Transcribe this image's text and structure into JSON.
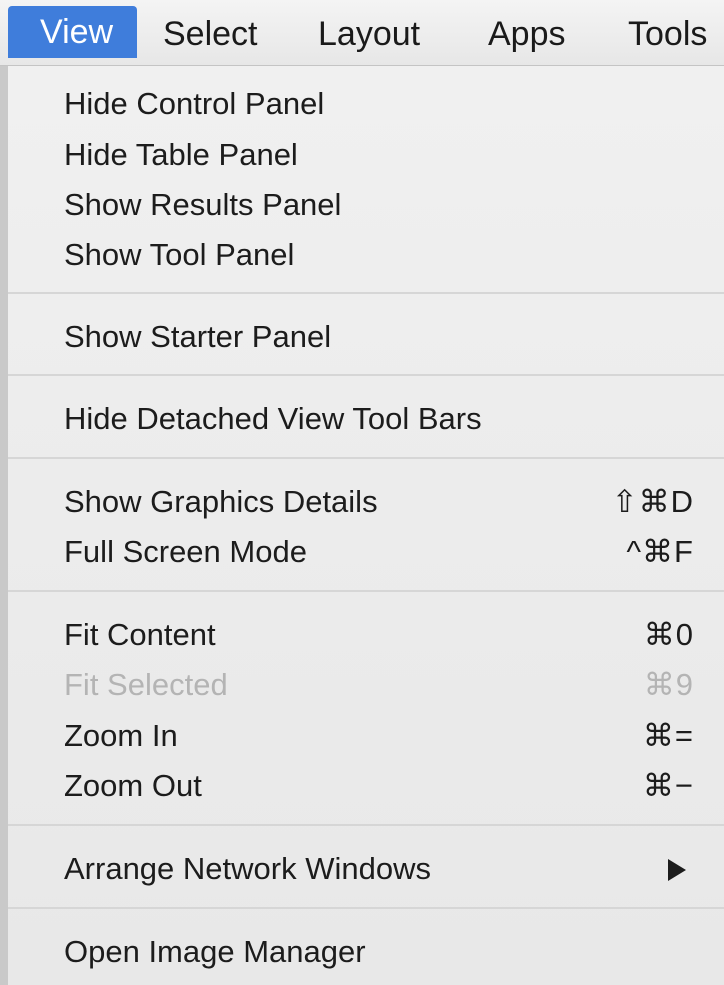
{
  "menubar": {
    "items": [
      {
        "label": "View",
        "active": true
      },
      {
        "label": "Select"
      },
      {
        "label": "Layout"
      },
      {
        "label": "Apps"
      },
      {
        "label": "Tools"
      }
    ]
  },
  "menu": {
    "groups": [
      {
        "items": [
          {
            "label": "Hide Control Panel"
          },
          {
            "label": "Hide Table Panel"
          },
          {
            "label": "Show Results Panel"
          },
          {
            "label": "Show Tool Panel"
          }
        ]
      },
      {
        "items": [
          {
            "label": "Show Starter Panel"
          }
        ]
      },
      {
        "items": [
          {
            "label": "Hide Detached View Tool Bars"
          }
        ]
      },
      {
        "items": [
          {
            "label": "Show Graphics Details",
            "shortcut": "⇧⌘D"
          },
          {
            "label": "Full Screen Mode",
            "shortcut": "^⌘F"
          }
        ]
      },
      {
        "items": [
          {
            "label": "Fit Content",
            "shortcut": "⌘0"
          },
          {
            "label": "Fit Selected",
            "shortcut": "⌘9",
            "disabled": true
          },
          {
            "label": "Zoom In",
            "shortcut": "⌘="
          },
          {
            "label": "Zoom Out",
            "shortcut": "⌘−"
          }
        ]
      },
      {
        "items": [
          {
            "label": "Arrange Network Windows",
            "submenu_icon": "triangle-right-icon"
          }
        ]
      },
      {
        "items": [
          {
            "label": "Open Image Manager"
          }
        ]
      }
    ]
  },
  "colors": {
    "accent": "#3f7ddb",
    "disabled_text": "#b4b4b4"
  }
}
